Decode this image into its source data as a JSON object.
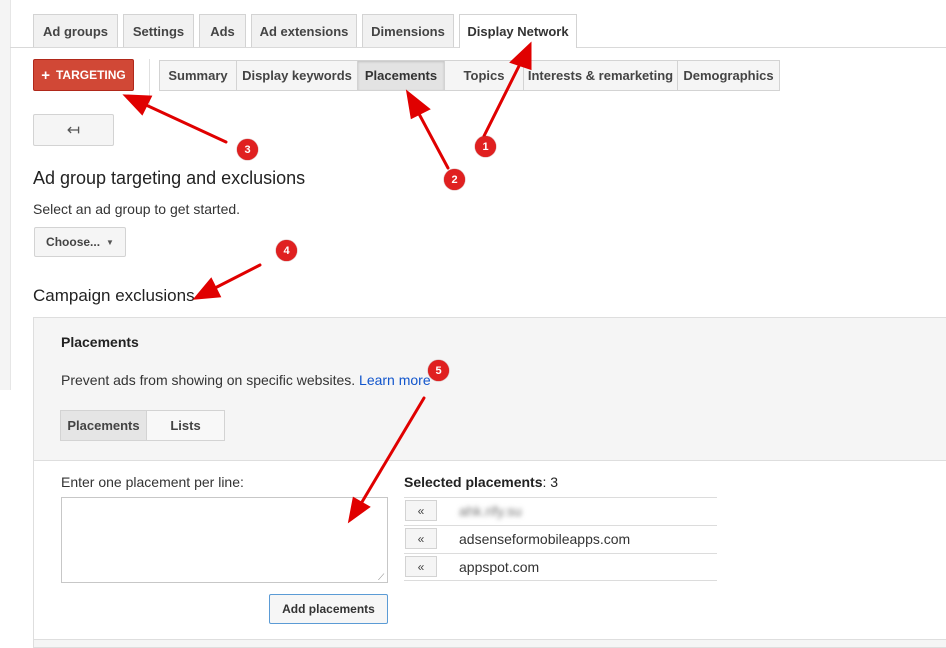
{
  "main_tabs": [
    {
      "label": "Ad groups"
    },
    {
      "label": "Settings"
    },
    {
      "label": "Ads"
    },
    {
      "label": "Ad extensions"
    },
    {
      "label": "Dimensions"
    },
    {
      "label": "Display Network",
      "active": true
    }
  ],
  "targeting_button": {
    "label": "TARGETING",
    "icon": "plus-icon"
  },
  "sub_tabs": [
    {
      "label": "Summary"
    },
    {
      "label": "Display keywords"
    },
    {
      "label": "Placements",
      "active": true
    },
    {
      "label": "Topics"
    },
    {
      "label": "Interests & remarketing"
    },
    {
      "label": "Demographics"
    }
  ],
  "back_button": {
    "icon": "back-arrow-icon",
    "glyph": "↤"
  },
  "ad_group_section": {
    "title": "Ad group targeting and exclusions",
    "subtitle": "Select an ad group to get started.",
    "choose_label": "Choose..."
  },
  "campaign_exclusions": {
    "title": "Campaign exclusions",
    "panel_title": "Placements",
    "description": "Prevent ads from showing on specific websites.",
    "learn_more": "Learn more",
    "segments": [
      "Placements",
      "Lists"
    ],
    "enter_label": "Enter one placement per line:",
    "textarea_value": "",
    "add_button": "Add placements",
    "selected_label": "Selected placements",
    "selected_count": ": 3",
    "remove_glyph": "«",
    "selected_items": [
      "ahk.rify.su",
      "adsenseformobileapps.com",
      "appspot.com"
    ]
  },
  "annotations": [
    "1",
    "2",
    "3",
    "4",
    "5"
  ],
  "colors": {
    "targeting_red": "#d14836",
    "badge_red": "#e02020",
    "link_blue": "#1155cc"
  }
}
